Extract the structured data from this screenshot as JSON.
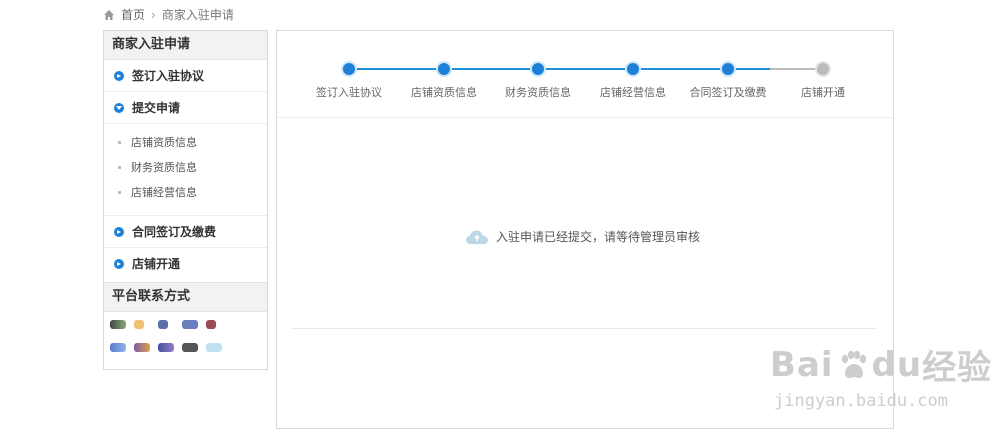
{
  "breadcrumb": {
    "home": "首页",
    "current": "商家入驻申请"
  },
  "sidebar": {
    "title": "商家入驻申请",
    "items": [
      {
        "label": "签订入驻协议"
      },
      {
        "label": "提交申请"
      },
      {
        "label": "合同签订及缴费"
      },
      {
        "label": "店铺开通"
      }
    ],
    "subitems": [
      {
        "label": "店铺资质信息"
      },
      {
        "label": "财务资质信息"
      },
      {
        "label": "店铺经营信息"
      }
    ],
    "contact_title": "平台联系方式"
  },
  "steps": [
    {
      "label": "签订入驻协议",
      "state": "done"
    },
    {
      "label": "店铺资质信息",
      "state": "done"
    },
    {
      "label": "财务资质信息",
      "state": "done"
    },
    {
      "label": "店铺经营信息",
      "state": "done"
    },
    {
      "label": "合同签订及缴费",
      "state": "done"
    },
    {
      "label": "店铺开通",
      "state": "pending"
    }
  ],
  "main": {
    "message": "入驻申请已经提交，请等待管理员审核"
  },
  "watermark": {
    "brand_left": "Bai",
    "brand_right": "经验",
    "brand_mid": "du",
    "url": "jingyan.baidu.com"
  },
  "colors": {
    "accent": "#1e7fd6",
    "pending": "#bbbbbb"
  }
}
